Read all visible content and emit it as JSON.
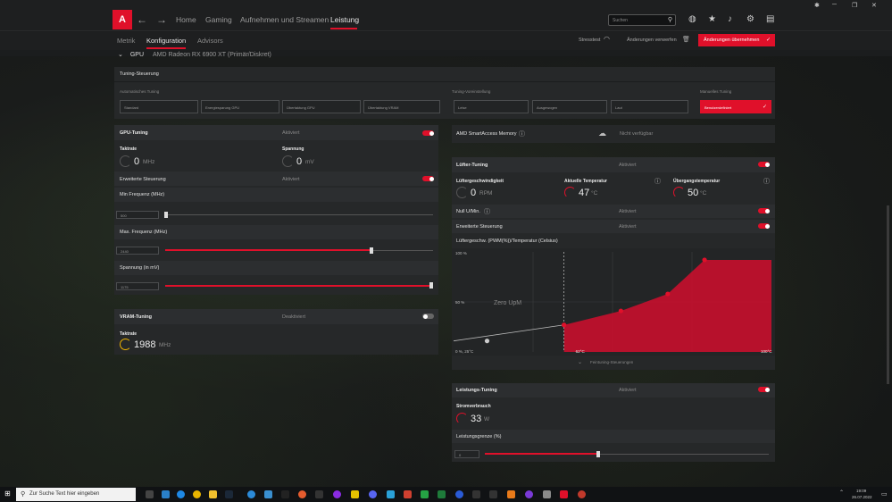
{
  "nav": {
    "items": [
      "Home",
      "Gaming",
      "Aufnehmen und Streamen",
      "Leistung"
    ],
    "active": "Leistung",
    "search_placeholder": "Suchen"
  },
  "subnav": {
    "tabs": [
      "Metrik",
      "Konfiguration",
      "Advisors"
    ],
    "active": "Konfiguration",
    "stresstest": "Stresstest",
    "discard": "Änderungen verwerfen",
    "apply": "Änderungen übernehmen"
  },
  "gpu": {
    "label": "GPU",
    "name": "AMD Radeon RX 6900 XT (Primär/Diskret)"
  },
  "tuning_control": {
    "title": "Tuning-Steuerung",
    "auto_label": "Automatisches Tuning",
    "auto_options": [
      "Standard",
      "Energiesparung GPU",
      "Übertaktung GPU",
      "Übertaktung VRAM"
    ],
    "preset_label": "Tuning-Voreinstellung",
    "preset_options": [
      "Leise",
      "Ausgewogen",
      "Laut"
    ],
    "manual_label": "Manuelles Tuning",
    "manual_option": "Benutzerdefiniert"
  },
  "gpu_tuning": {
    "title": "GPU-Tuning",
    "status": "Aktiviert",
    "enabled": true,
    "clock_label": "Taktrate",
    "clock_value": "0",
    "clock_unit": "MHz",
    "voltage_label": "Spannung",
    "voltage_value": "0",
    "voltage_unit": "mV",
    "advanced_label": "Erweiterte Steuerung",
    "advanced_status": "Aktiviert",
    "advanced_enabled": true,
    "min_freq_label": "Min Frequenz (MHz)",
    "min_freq_value": "500",
    "min_freq_fraction": 0.0,
    "max_freq_label": "Max. Frequenz (MHz)",
    "max_freq_value": "2440",
    "max_freq_fraction": 0.77,
    "voltage_slider_label": "Spannung (in mV)",
    "voltage_slider_value": "1175",
    "voltage_slider_fraction": 1.0
  },
  "vram_tuning": {
    "title": "VRAM-Tuning",
    "status": "Deaktiviert",
    "enabled": false,
    "clock_label": "Taktrate",
    "clock_value": "1988",
    "clock_unit": "MHz"
  },
  "sam": {
    "label": "AMD SmartAccess Memory",
    "status": "Nicht verfügbar"
  },
  "fan_tuning": {
    "title": "Lüfter-Tuning",
    "status": "Aktiviert",
    "enabled": true,
    "speed_label": "Lüftergeschwindigkeit",
    "speed_value": "0",
    "speed_unit": "RPM",
    "temp_label": "Aktuelle Temperatur",
    "temp_value": "47",
    "temp_unit": "°C",
    "junction_label": "Übergangstemperatur",
    "junction_value": "50",
    "junction_unit": "°C",
    "zero_rpm_label": "Null U/Min.",
    "zero_rpm_status": "Aktiviert",
    "advanced_label": "Erweiterte Steuerung",
    "advanced_status": "Aktiviert",
    "curve_label": "Lüftergeschw. (PWM(%))/Temperatur (Celsius)",
    "fine_tuning": "Feintuning-Steuerungen"
  },
  "chart_data": {
    "type": "area",
    "y_ticks": [
      "100 %",
      "50 %",
      "0 %, 25°C"
    ],
    "x_ticks": [
      "62°C",
      "100°C"
    ],
    "annotation": "Zero UpM",
    "x": [
      25,
      35,
      58,
      75,
      89,
      100
    ],
    "y": [
      11,
      11,
      27,
      41,
      58,
      92
    ],
    "series": [
      {
        "values": [
          11,
          11,
          27,
          41,
          58,
          92
        ]
      }
    ],
    "xlim": [
      25,
      120
    ],
    "ylim": [
      0,
      100
    ],
    "colors": {
      "fill": "#c8102e",
      "line": "#e0102a"
    }
  },
  "power_tuning": {
    "title": "Leistungs-Tuning",
    "status": "Aktiviert",
    "enabled": true,
    "consumption_label": "Stromverbrauch",
    "consumption_value": "33",
    "consumption_unit": "W",
    "limit_label": "Leistungsgrenze (%)",
    "limit_value": "0",
    "limit_fraction": 0.5
  },
  "taskbar": {
    "search": "Zur Suche Text hier eingeben",
    "time": "19:09",
    "date": "26.07.2022"
  },
  "colors": {
    "accent": "#e0102a"
  }
}
